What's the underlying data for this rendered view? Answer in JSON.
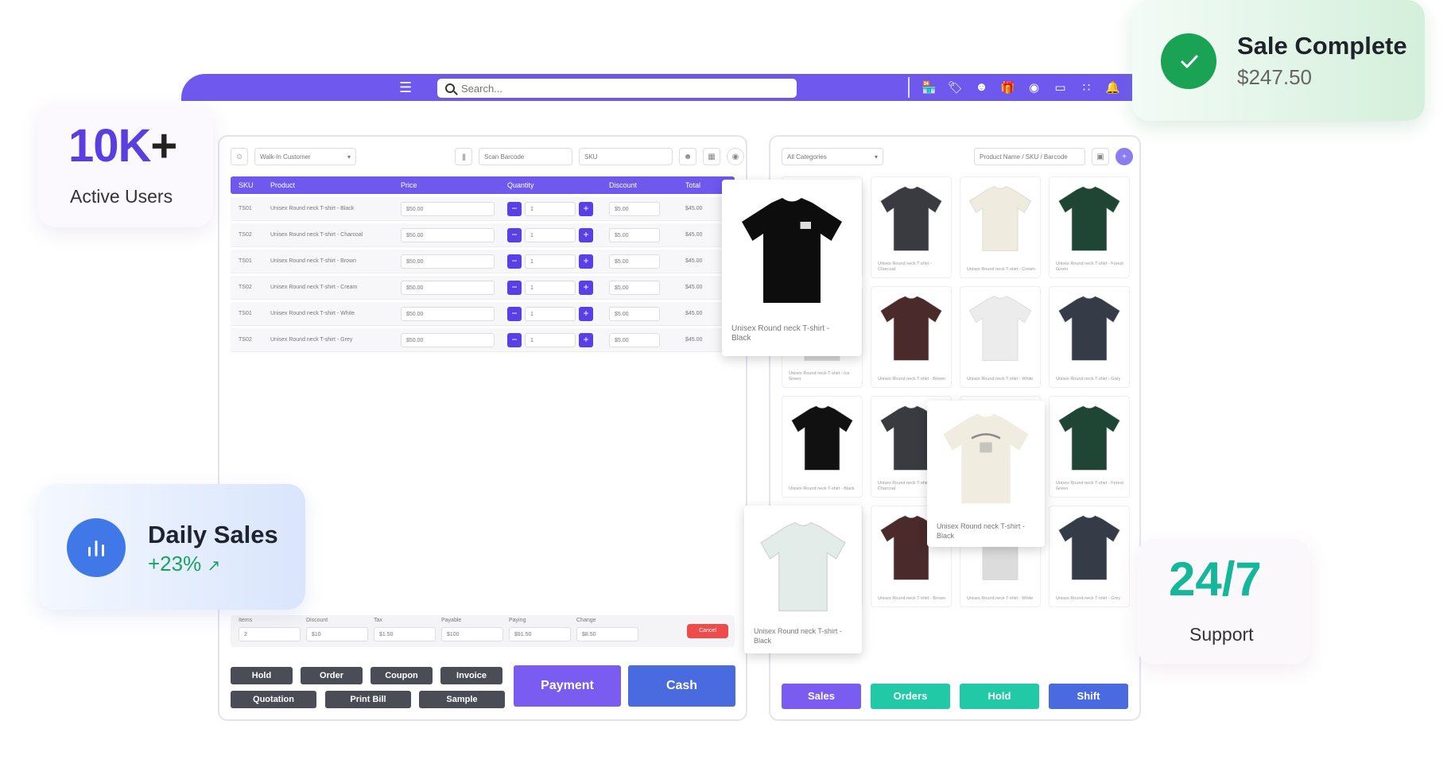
{
  "topbar": {
    "search_placeholder": "Search..."
  },
  "left": {
    "customer_select": "Walk-In Customer",
    "barcode_placeholder": "Scan Barcode",
    "sku_placeholder": "SKU",
    "headers": [
      "SKU",
      "Product",
      "Price",
      "Quantity",
      "Discount",
      "Total"
    ],
    "rows": [
      {
        "sku": "TS01",
        "product": "Unisex Round neck T-shirt - Black",
        "price": "$50.00",
        "qty": "1",
        "discount": "$5.00",
        "total": "$45.00"
      },
      {
        "sku": "TS02",
        "product": "Unisex Round neck T-shirt - Charcoal",
        "price": "$50.00",
        "qty": "1",
        "discount": "$5.00",
        "total": "$45.00"
      },
      {
        "sku": "TS01",
        "product": "Unisex Round neck T-shirt - Brown",
        "price": "$50.00",
        "qty": "1",
        "discount": "$5.00",
        "total": "$45.00"
      },
      {
        "sku": "TS02",
        "product": "Unisex Round neck T-shirt - Cream",
        "price": "$50.00",
        "qty": "1",
        "discount": "$5.00",
        "total": "$45.00"
      },
      {
        "sku": "TS01",
        "product": "Unisex Round neck T-shirt - White",
        "price": "$50.00",
        "qty": "1",
        "discount": "$5.00",
        "total": "$45.00"
      },
      {
        "sku": "TS02",
        "product": "Unisex Round neck T-shirt - Grey",
        "price": "$50.00",
        "qty": "1",
        "discount": "$5.00",
        "total": "$45.00"
      }
    ],
    "summary": {
      "items_label": "Items",
      "items": "2",
      "discount_label": "Discount",
      "discount": "$10",
      "tax_label": "Tax",
      "tax": "$1.50",
      "payable_label": "Payable",
      "payable": "$100",
      "paying_label": "Paying",
      "paying": "$91.50",
      "change_label": "Change",
      "change": "$8.50",
      "cancel": "Cancel"
    },
    "actions": {
      "hold": "Hold",
      "order": "Order",
      "coupon": "Coupon",
      "invoice": "Invoice",
      "quotation": "Quotation",
      "print_bill": "Print Bill",
      "sample": "Sample",
      "payment": "Payment",
      "cash": "Cash"
    }
  },
  "right": {
    "category_select": "All Categories",
    "product_search_placeholder": "Product Name / SKU / Barcode",
    "products": [
      {
        "name": "Unisex Round neck T-shirt - Ice Green",
        "color": "#eeeeee"
      },
      {
        "name": "Unisex Round neck T-shirt - Charcoal",
        "color": "#3a3b40"
      },
      {
        "name": "Unisex Round neck T-shirt - Cream",
        "color": "#f0ebdf"
      },
      {
        "name": "Unisex Round neck T-shirt - Forest Green",
        "color": "#1f4634"
      },
      {
        "name": "Unisex Round neck T-shirt - Ice Green",
        "color": "#d9d9d9"
      },
      {
        "name": "Unisex Round neck T-shirt - Brown",
        "color": "#4a2a2a"
      },
      {
        "name": "Unisex Round neck T-shirt - White",
        "color": "#ececec"
      },
      {
        "name": "Unisex Round neck T-shirt - Grey",
        "color": "#363b48"
      },
      {
        "name": "Unisex Round neck T-shirt - Black",
        "color": "#111111"
      },
      {
        "name": "Unisex Round neck T-shirt - Charcoal",
        "color": "#3a3b40"
      },
      {
        "name": "Unisex Round neck T-shirt - Cream",
        "color": "#f0ebdf"
      },
      {
        "name": "Unisex Round neck T-shirt - Forest Green",
        "color": "#1f4634"
      },
      {
        "name": "Unisex Round neck T-shirt - Black",
        "color": "#111111"
      },
      {
        "name": "Unisex Round neck T-shirt - Brown",
        "color": "#4a2a2a"
      },
      {
        "name": "Unisex Round neck T-shirt - White",
        "color": "#dcdcdc"
      },
      {
        "name": "Unisex Round neck T-shirt - Grey",
        "color": "#363b48"
      }
    ],
    "popup_black": "Unisex Round neck T-shirt - Black",
    "popup_cream": "Unisex Round neck T-shirt - Black",
    "popup_white": "Unisex Round neck T-shirt - Black",
    "bottom": {
      "sales": "Sales",
      "orders": "Orders",
      "hold": "Hold",
      "shift": "Shift"
    }
  },
  "stats": {
    "users_value": "10K",
    "users_plus": "+",
    "users_label": "Active Users",
    "daily_title": "Daily Sales",
    "daily_pct": "+23%",
    "sale_title": "Sale Complete",
    "sale_amount": "$247.50",
    "support_value": "24/7",
    "support_label": "Support"
  },
  "colors": {
    "brand": "#6e58ee",
    "success": "#1aa354",
    "danger": "#ef4b4b",
    "teal": "#14b79a",
    "blue": "#4a6be0"
  },
  "icons": [
    "store-icon",
    "promo-icon",
    "users-icon",
    "gift-icon",
    "coin-icon",
    "device-icon",
    "grid-icon",
    "bell-icon"
  ]
}
